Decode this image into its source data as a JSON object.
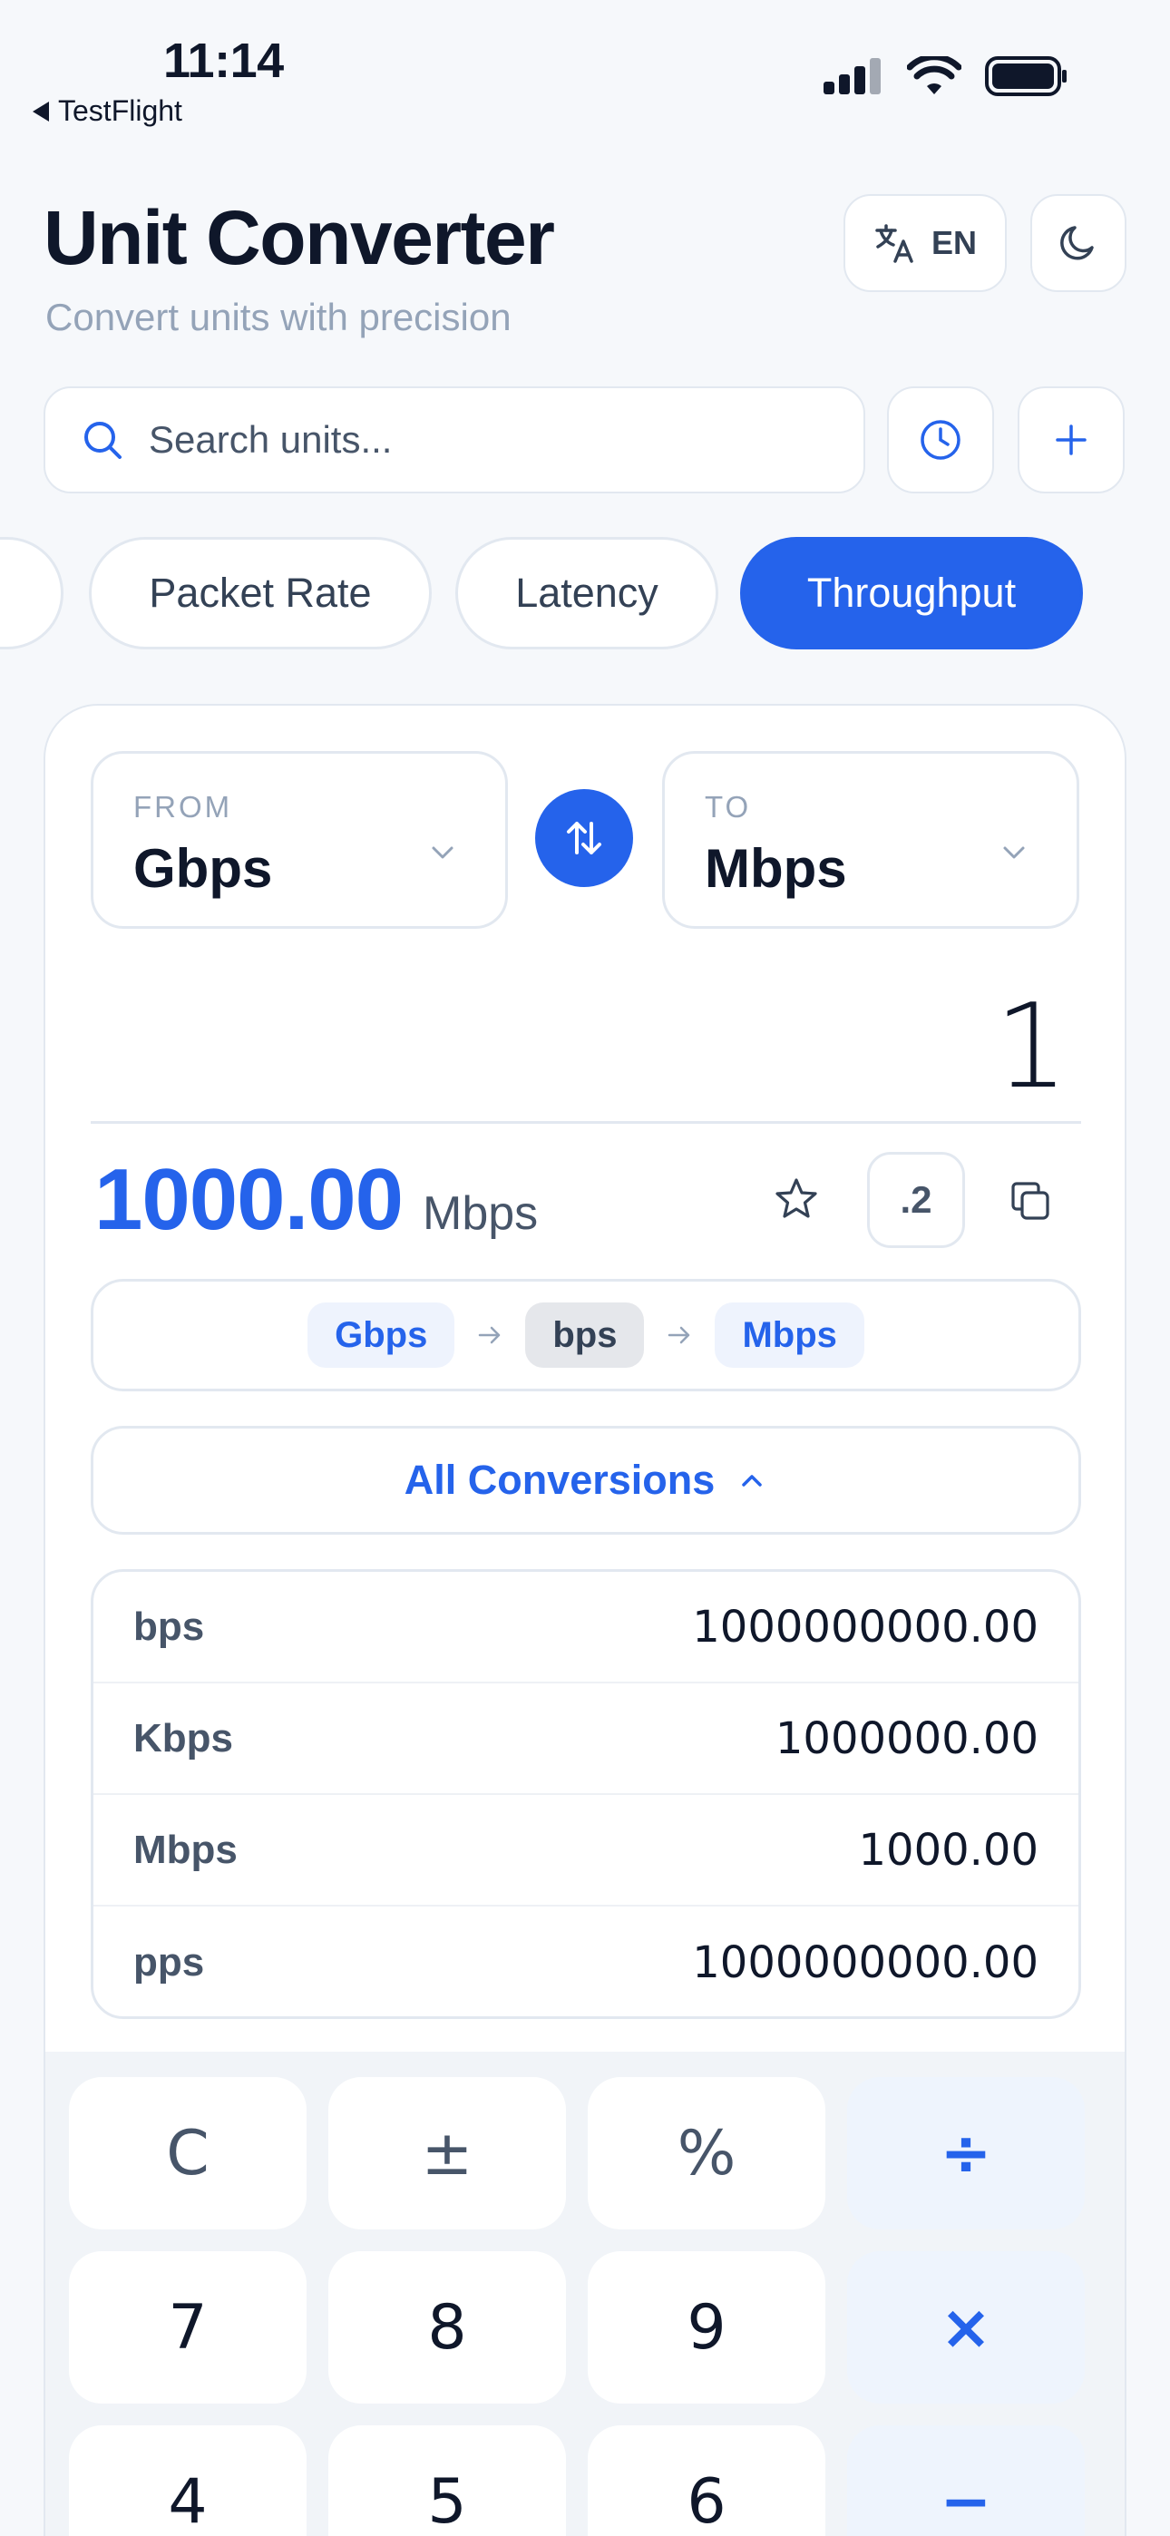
{
  "status_bar": {
    "time": "11:14",
    "back_app": "TestFlight"
  },
  "header": {
    "title": "Unit Converter",
    "subtitle": "Convert units with precision",
    "language_label": "EN"
  },
  "search": {
    "placeholder": "Search units..."
  },
  "categories": [
    "Packet Rate",
    "Latency",
    "Throughput"
  ],
  "active_category": "Throughput",
  "converter": {
    "from_label": "FROM",
    "from_unit": "Gbps",
    "to_label": "TO",
    "to_unit": "Mbps",
    "input_value": "1",
    "result_value": "1000.00",
    "result_unit": "Mbps",
    "precision_label": ".2"
  },
  "conversion_path": [
    "Gbps",
    "bps",
    "Mbps"
  ],
  "all_conversions": {
    "toggle_label": "All Conversions",
    "rows": [
      {
        "unit": "bps",
        "value": "1000000000.00"
      },
      {
        "unit": "Kbps",
        "value": "1000000.00"
      },
      {
        "unit": "Mbps",
        "value": "1000.00"
      },
      {
        "unit": "pps",
        "value": "1000000000.00"
      }
    ]
  },
  "keypad": {
    "row1": [
      "C",
      "±",
      "%",
      "÷"
    ],
    "row2": [
      "7",
      "8",
      "9",
      "×"
    ],
    "row3": [
      "4",
      "5",
      "6",
      "−"
    ]
  },
  "colors": {
    "accent": "#2563eb",
    "background": "#f6f8fb",
    "border": "#e2e8f0"
  }
}
